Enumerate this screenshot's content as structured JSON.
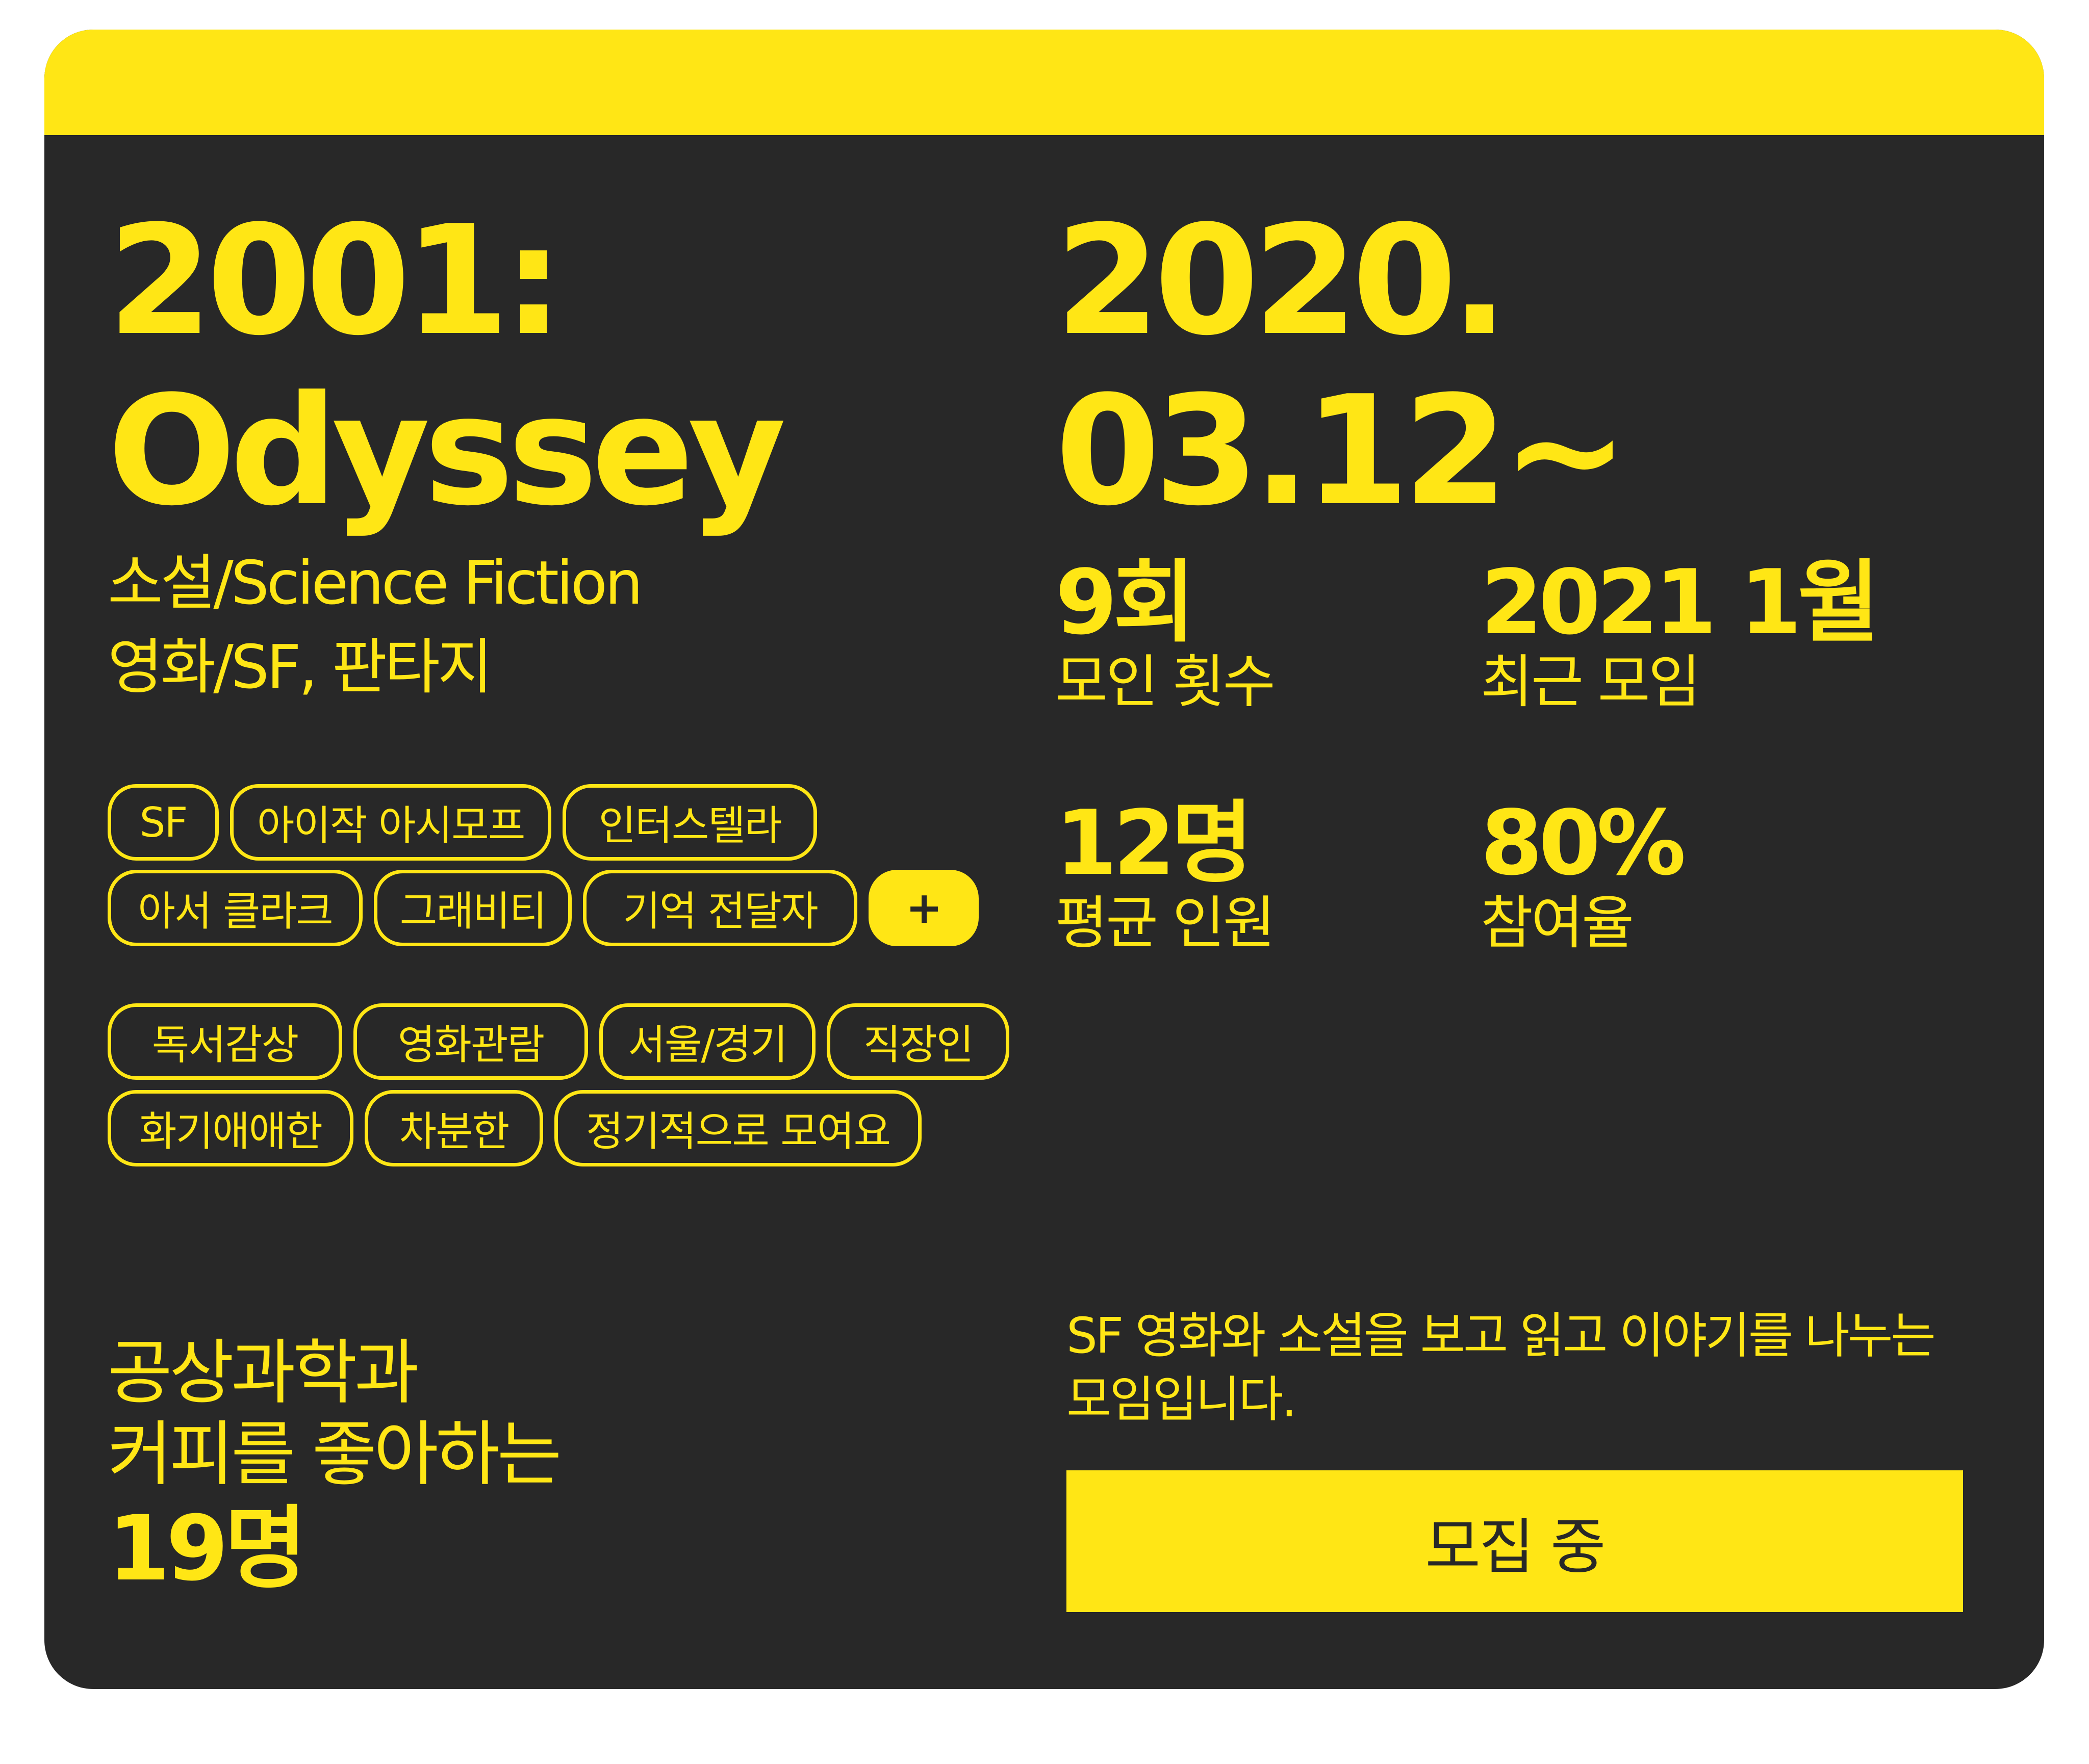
{
  "theme": {
    "accent": "#FFE615",
    "background": "#282828"
  },
  "club": {
    "title_line1": "2001:",
    "title_line2": "Odyssey",
    "genre_line1": "소설/Science Fiction",
    "genre_line2": "영화/SF, 판타지",
    "date_line1": "2020.",
    "date_line2": "03.12~"
  },
  "stats": [
    {
      "value": "9회",
      "label": "모인 횟수"
    },
    {
      "value": "2021 1월",
      "label": "최근 모임"
    },
    {
      "value": "12명",
      "label": "평균 인원"
    },
    {
      "value": "80%",
      "label": "참여율"
    }
  ],
  "keyword_tags": {
    "row1": [
      "SF",
      "아이작 아시모프",
      "인터스텔라"
    ],
    "row2": [
      "아서 클라크",
      "그래비티",
      "기억 전달자"
    ],
    "more_label": "+"
  },
  "mood_tags": {
    "row1": [
      "독서감상",
      "영화관람",
      "서울/경기",
      "직장인"
    ],
    "row2": [
      "화기애애한",
      "차분한",
      "정기적으로 모여요"
    ]
  },
  "members": {
    "line1": "공상과학과",
    "line2": "커피를 좋아하는",
    "count": "19명"
  },
  "description": {
    "line1": "SF 영화와 소설을 보고 읽고 이야기를 나누는",
    "line2": "모임입니다."
  },
  "status_button": {
    "label": "모집 중"
  }
}
